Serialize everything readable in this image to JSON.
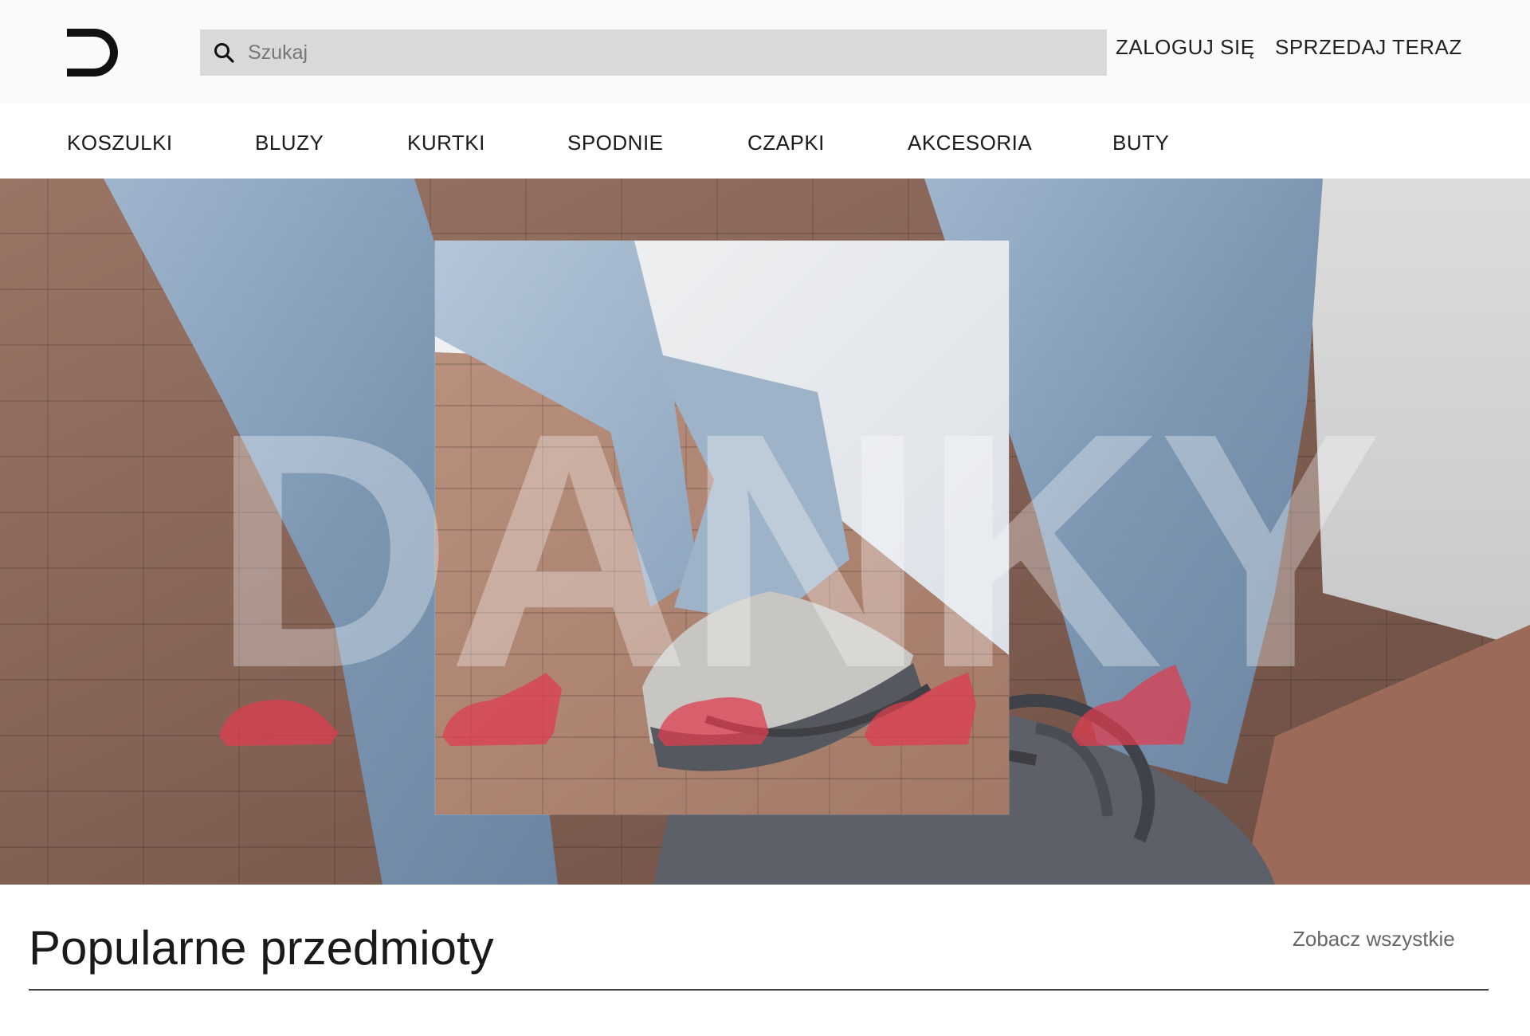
{
  "header": {
    "logo_icon": "d-logo-icon",
    "search": {
      "placeholder": "Szukaj",
      "value": "",
      "icon": "search-icon"
    },
    "login_label": "ZALOGUJ SIĘ",
    "sell_label": "SPRZEDAJ TERAZ"
  },
  "categories": [
    {
      "label": "KOSZULKI"
    },
    {
      "label": "BLUZY"
    },
    {
      "label": "KURTKI"
    },
    {
      "label": "SPODNIE"
    },
    {
      "label": "CZAPKI"
    },
    {
      "label": "AKCESORIA"
    },
    {
      "label": "BUTY"
    }
  ],
  "hero": {
    "brand_text": "DANKY",
    "sneaker_count": 5,
    "colors": {
      "denim": "#7f9bb8",
      "wall": "#8a6a5c",
      "sneaker_accent": "#d9424f"
    }
  },
  "popular": {
    "title": "Popularne przedmioty",
    "see_all_label": "Zobacz wszystkie"
  }
}
